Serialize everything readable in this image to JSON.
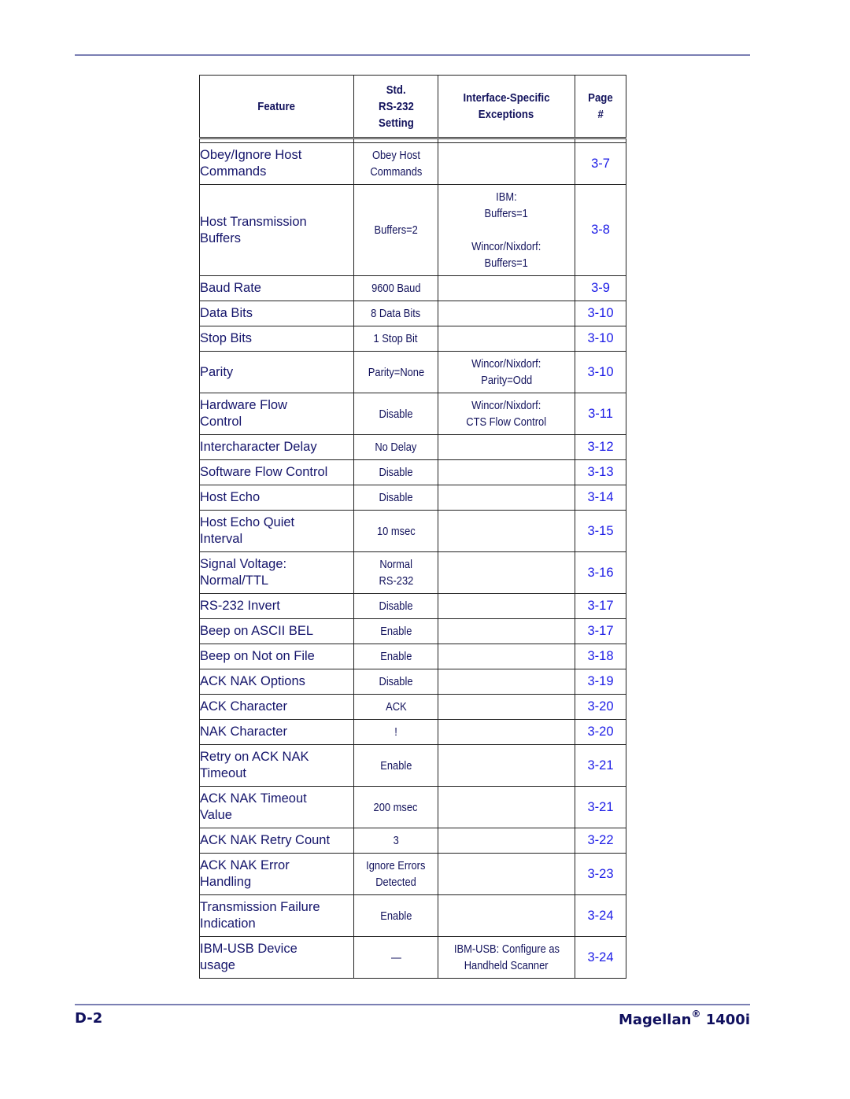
{
  "header": {
    "columns": {
      "feature": "Feature",
      "std_line1": "Std.",
      "std_line2": "RS-232",
      "std_line3": "Setting",
      "exc_line1": "Interface-Specific",
      "exc_line2": "Exceptions",
      "page_line1": "Page",
      "page_line2": "#"
    }
  },
  "rows": [
    {
      "feature": [
        "Obey/Ignore Host",
        "Commands"
      ],
      "std": [
        "Obey Host",
        "Commands"
      ],
      "exc": [],
      "page": "3-7"
    },
    {
      "feature": [
        "Host Transmission",
        "Buffers"
      ],
      "std": [
        "Buffers=2"
      ],
      "exc": [
        "IBM:",
        "Buffers=1",
        "",
        "Wincor/Nixdorf:",
        "Buffers=1"
      ],
      "page": "3-8"
    },
    {
      "feature": [
        "Baud Rate"
      ],
      "std": [
        "9600 Baud"
      ],
      "exc": [],
      "page": "3-9"
    },
    {
      "feature": [
        "Data Bits"
      ],
      "std": [
        "8 Data Bits"
      ],
      "exc": [],
      "page": "3-10"
    },
    {
      "feature": [
        "Stop Bits"
      ],
      "std": [
        "1 Stop Bit"
      ],
      "exc": [],
      "page": "3-10"
    },
    {
      "feature": [
        "Parity"
      ],
      "std": [
        "Parity=None"
      ],
      "exc": [
        "Wincor/Nixdorf:",
        "Parity=Odd"
      ],
      "page": "3-10"
    },
    {
      "feature": [
        "Hardware Flow",
        "Control"
      ],
      "std": [
        "Disable"
      ],
      "exc": [
        "Wincor/Nixdorf:",
        "CTS Flow Control"
      ],
      "page": "3-11"
    },
    {
      "feature": [
        "Intercharacter Delay"
      ],
      "std": [
        "No Delay"
      ],
      "exc": [],
      "page": "3-12"
    },
    {
      "feature": [
        "Software Flow Control"
      ],
      "std": [
        "Disable"
      ],
      "exc": [],
      "page": "3-13"
    },
    {
      "feature": [
        "Host Echo"
      ],
      "std": [
        "Disable"
      ],
      "exc": [],
      "page": "3-14"
    },
    {
      "feature": [
        "Host Echo Quiet",
        "Interval"
      ],
      "std": [
        "10 msec"
      ],
      "exc": [],
      "page": "3-15"
    },
    {
      "feature": [
        "Signal Voltage:",
        "Normal/TTL"
      ],
      "std": [
        "Normal",
        "RS-232"
      ],
      "exc": [],
      "page": "3-16"
    },
    {
      "feature": [
        "RS-232 Invert"
      ],
      "std": [
        "Disable"
      ],
      "exc": [],
      "page": "3-17"
    },
    {
      "feature": [
        "Beep on ASCII BEL"
      ],
      "std": [
        "Enable"
      ],
      "exc": [],
      "page": "3-17"
    },
    {
      "feature": [
        "Beep on Not on File"
      ],
      "std": [
        "Enable"
      ],
      "exc": [],
      "page": "3-18"
    },
    {
      "feature": [
        "ACK NAK Options"
      ],
      "std": [
        "Disable"
      ],
      "exc": [],
      "page": "3-19"
    },
    {
      "feature": [
        "ACK Character"
      ],
      "std": [
        "ACK"
      ],
      "exc": [],
      "page": "3-20"
    },
    {
      "feature": [
        "NAK Character"
      ],
      "std": [
        "!"
      ],
      "exc": [],
      "page": "3-20"
    },
    {
      "feature": [
        "Retry on ACK NAK",
        "Timeout"
      ],
      "std": [
        "Enable"
      ],
      "exc": [],
      "page": "3-21"
    },
    {
      "feature": [
        "ACK NAK Timeout",
        "Value"
      ],
      "std": [
        "200 msec"
      ],
      "exc": [],
      "page": "3-21"
    },
    {
      "feature": [
        "ACK NAK Retry Count"
      ],
      "std": [
        "3"
      ],
      "exc": [],
      "page": "3-22"
    },
    {
      "feature": [
        "ACK NAK Error",
        "Handling"
      ],
      "std": [
        "Ignore Errors",
        "Detected"
      ],
      "exc": [],
      "page": "3-23"
    },
    {
      "feature": [
        "Transmission Failure",
        "Indication"
      ],
      "std": [
        "Enable"
      ],
      "exc": [],
      "page": "3-24"
    },
    {
      "feature": [
        "IBM-USB Device",
        "usage"
      ],
      "std": [
        "—"
      ],
      "exc": [
        "IBM-USB: Configure as",
        "Handheld Scanner"
      ],
      "page": "3-24"
    }
  ],
  "footer": {
    "page_label": "D-2",
    "product_name": "Magellan",
    "product_mark": "®",
    "product_model": "1400i"
  },
  "colors": {
    "text_navy": "#15156b",
    "link_blue": "#1c1ce6",
    "rule": "#7b7fb3"
  }
}
